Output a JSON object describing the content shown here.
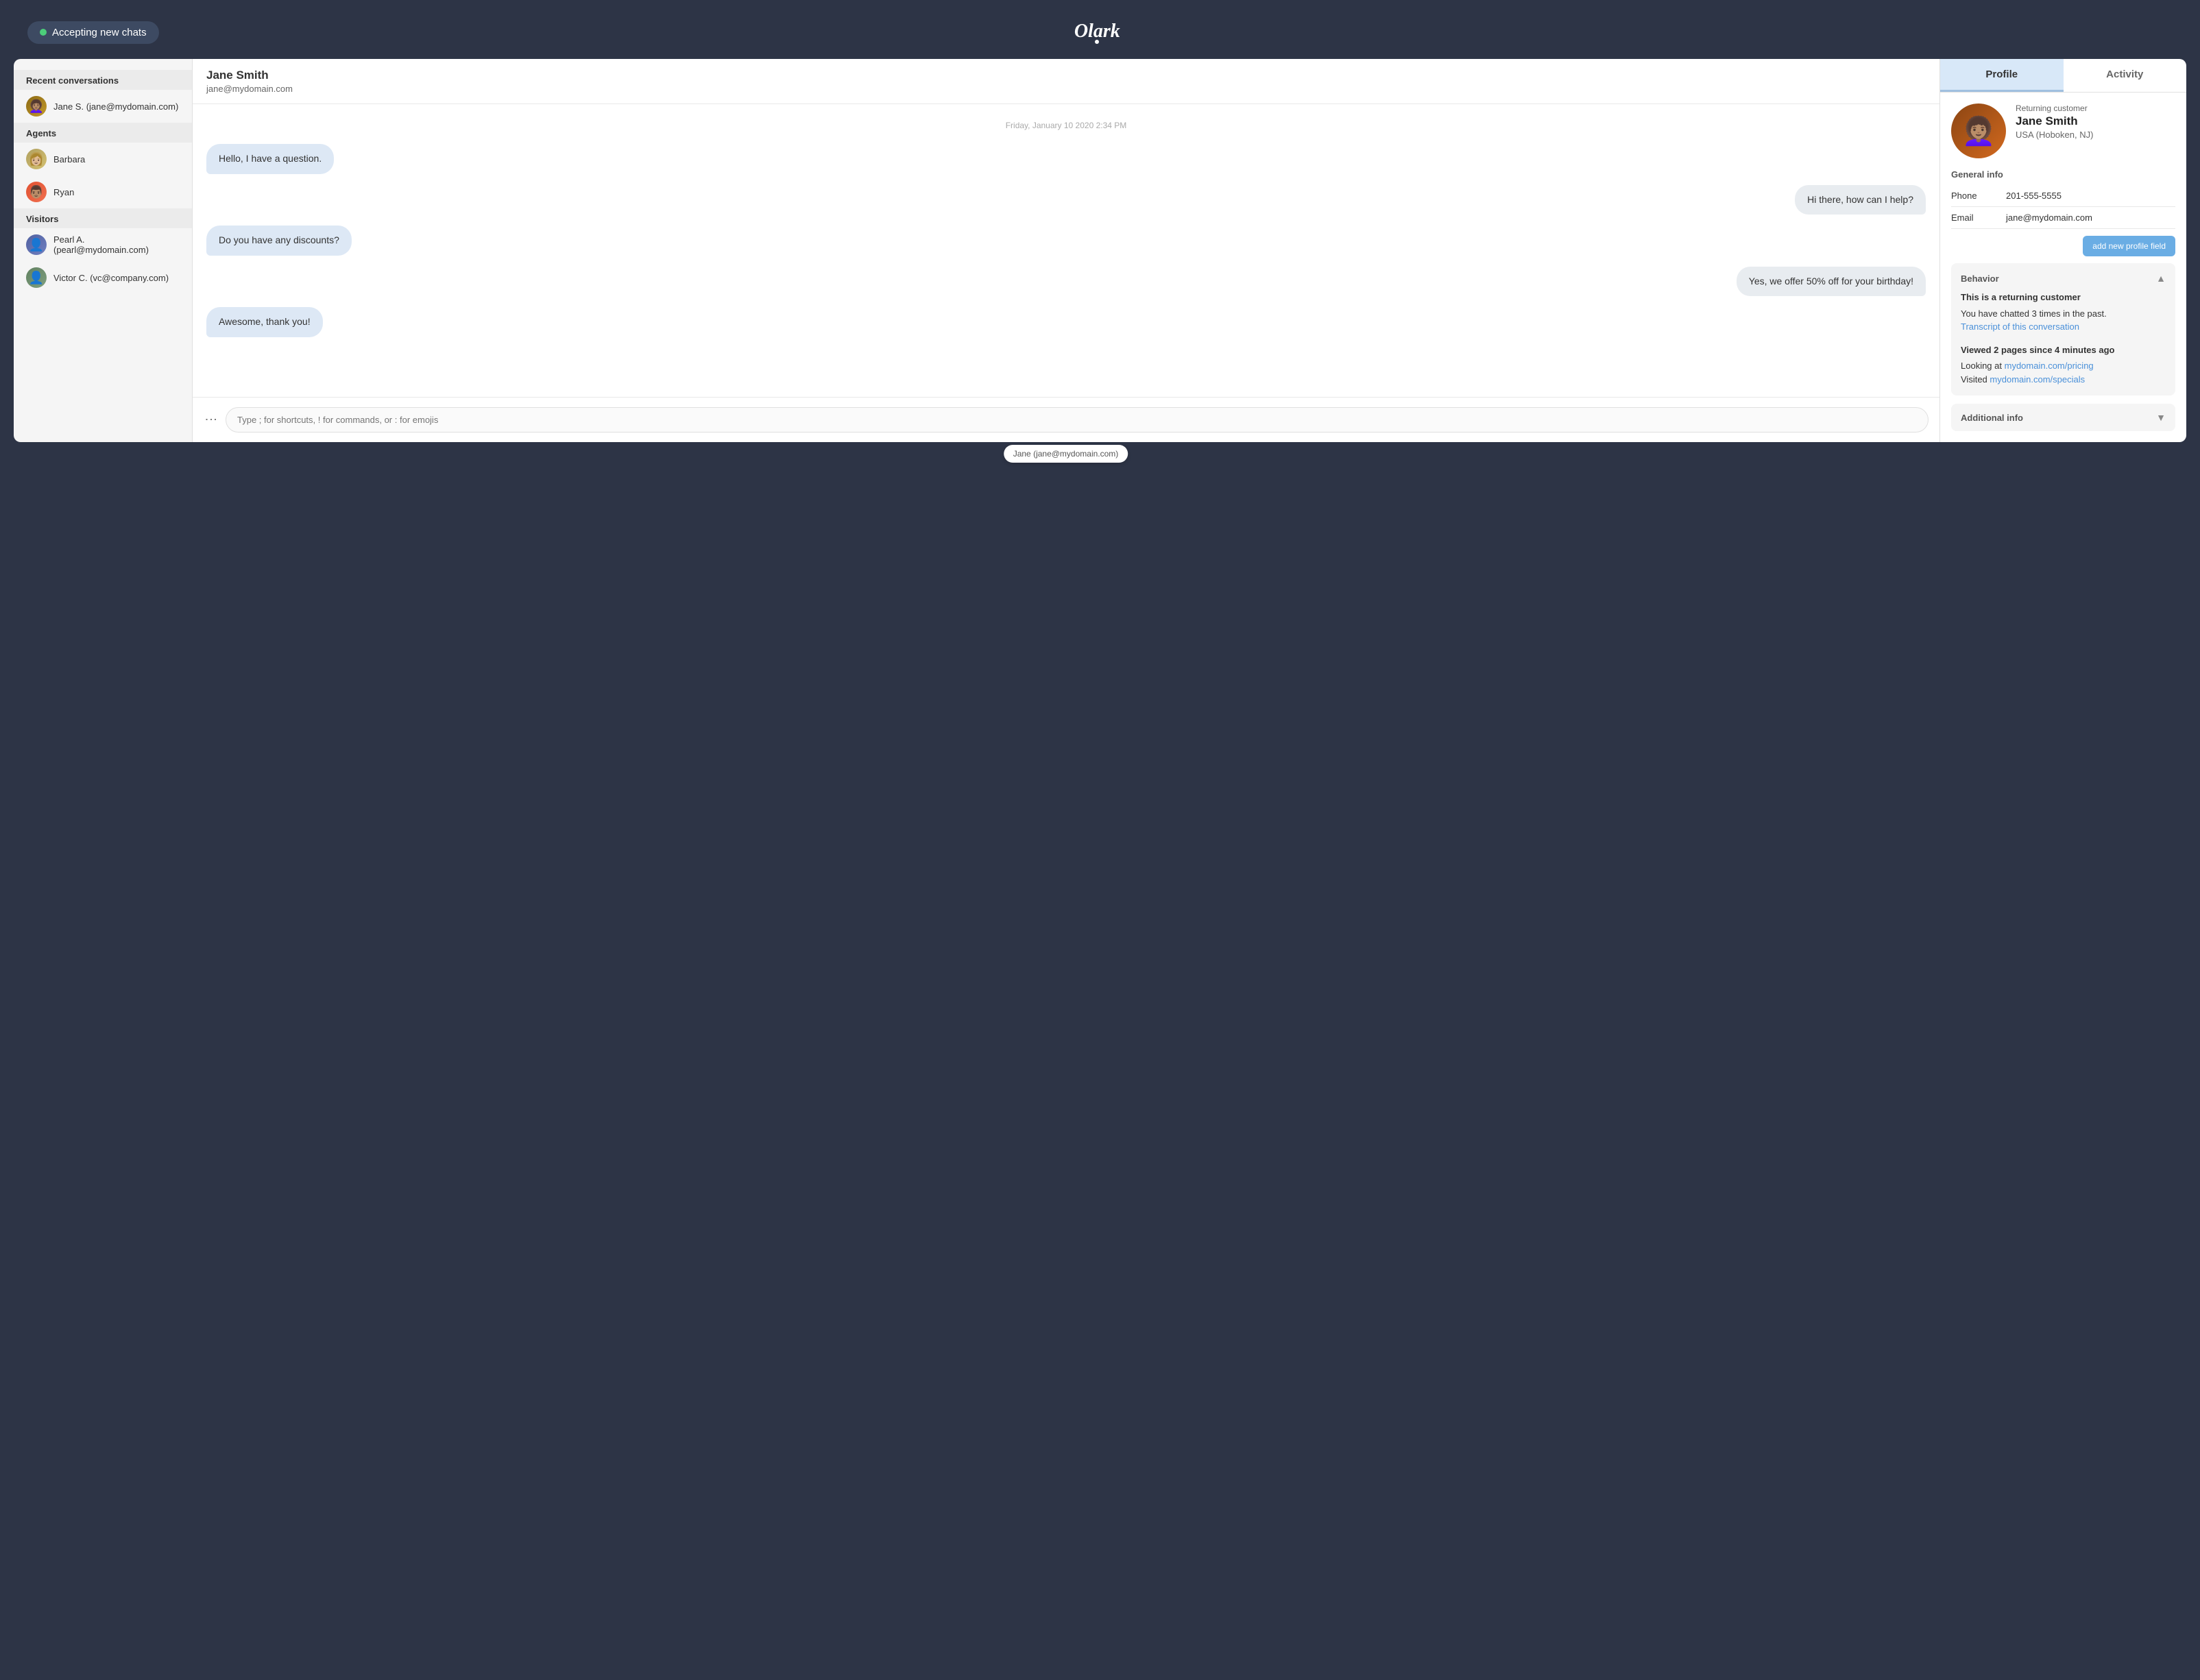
{
  "header": {
    "accepting_label": "Accepting new chats",
    "logo": "Olark"
  },
  "sidebar": {
    "recent_conversations_title": "Recent conversations",
    "jane_item": "Jane S. (jane@mydomain.com)",
    "agents_title": "Agents",
    "barbara_item": "Barbara",
    "ryan_item": "Ryan",
    "visitors_title": "Visitors",
    "pearl_item": "Pearl A. (pearl@mydomain.com)",
    "victor_item": "Victor C. (vc@company.com)"
  },
  "chat": {
    "name": "Jane Smith",
    "email": "jane@mydomain.com",
    "date_divider": "Friday, January 10 2020 2:34 PM",
    "messages": [
      {
        "text": "Hello, I have a question.",
        "side": "left"
      },
      {
        "text": "Hi there, how can I help?",
        "side": "right"
      },
      {
        "text": "Do you have any discounts?",
        "side": "left"
      },
      {
        "text": "Yes, we offer 50% off for your birthday!",
        "side": "right"
      },
      {
        "text": "Awesome, thank you!",
        "side": "left"
      }
    ],
    "input_placeholder": "Type ; for shortcuts, ! for commands, or : for emojis",
    "footer_badge": "Jane (jane@mydomain.com)"
  },
  "profile": {
    "tab_profile": "Profile",
    "tab_activity": "Activity",
    "returning_label": "Returning customer",
    "name": "Jane Smith",
    "location": "USA (Hoboken, NJ)",
    "general_info_title": "General info",
    "phone_label": "Phone",
    "phone_value": "201-555-5555",
    "email_label": "Email",
    "email_value": "jane@mydomain.com",
    "add_profile_btn": "add new profile field",
    "behavior_title": "Behavior",
    "behavior_bold": "This is a returning customer",
    "behavior_text1": "You have chatted 3 times in the past.",
    "behavior_text2": "Transcript of this conversation",
    "behavior_pages_bold": "Viewed 2 pages since 4 minutes ago",
    "behavior_looking": "Looking at ",
    "behavior_looking_link": "mydomain.com/pricing",
    "behavior_visited": "Visited ",
    "behavior_visited_link": "mydomain.com/specials",
    "additional_info_title": "Additional info"
  }
}
